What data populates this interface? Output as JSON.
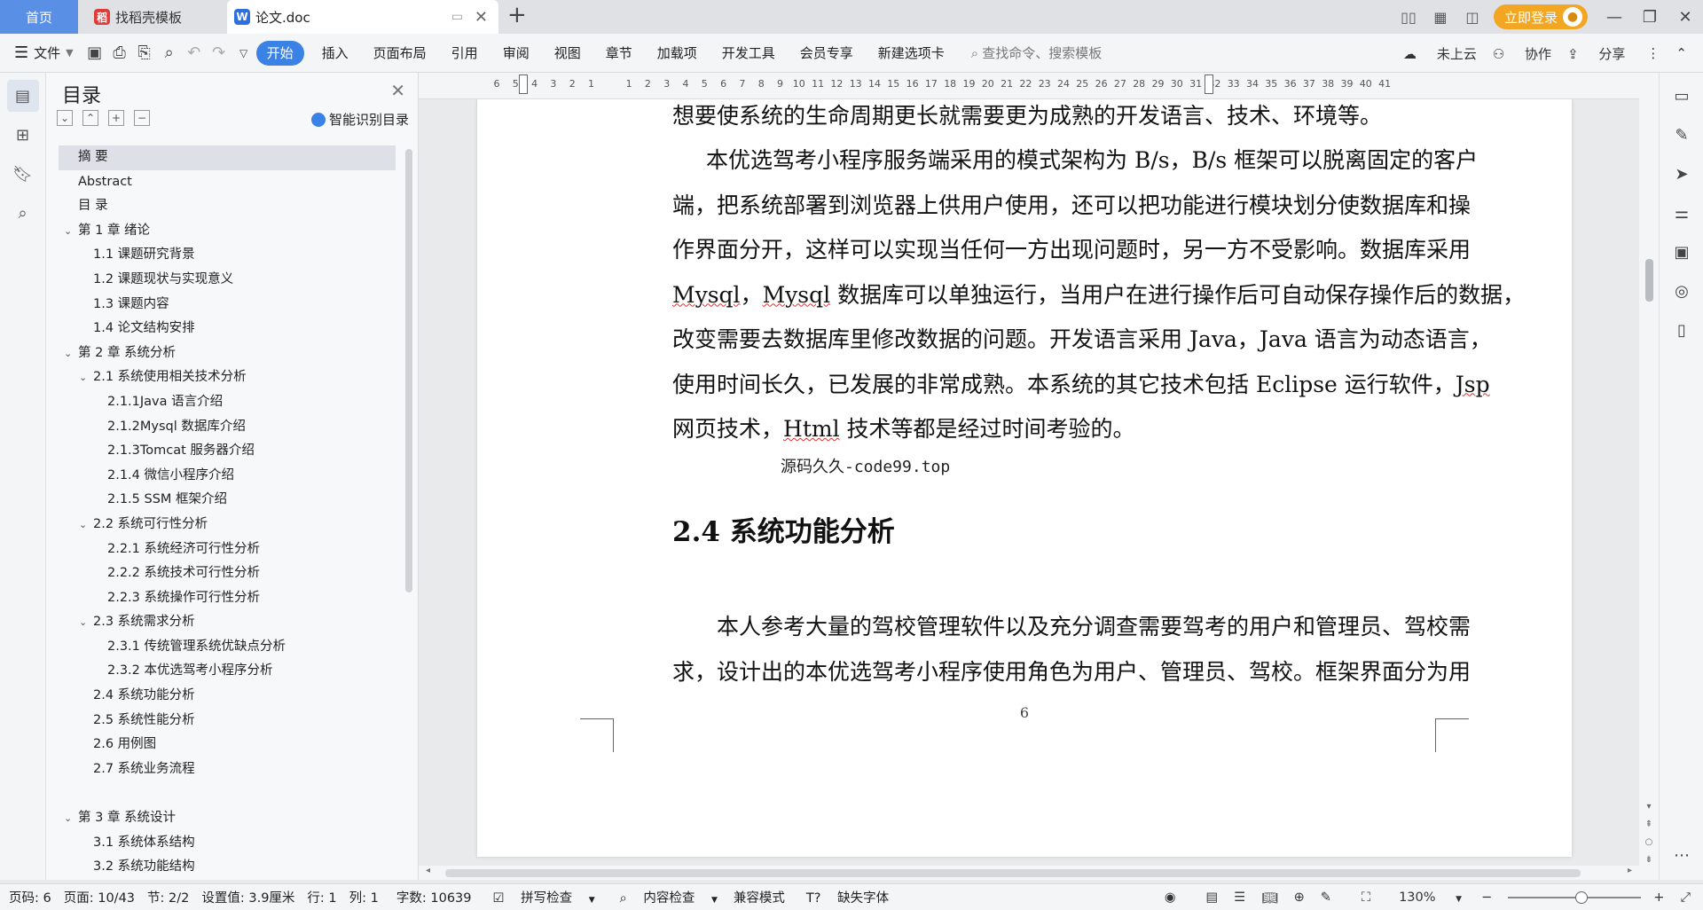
{
  "tabs": {
    "home": "首页",
    "find_template": "找稻壳模板",
    "document": "论文.doc"
  },
  "titlebar": {
    "login": "立即登录"
  },
  "menu": {
    "file": "文件",
    "items": [
      "开始",
      "插入",
      "页面布局",
      "引用",
      "审阅",
      "视图",
      "章节",
      "加载项",
      "开发工具",
      "会员专享",
      "新建选项卡"
    ],
    "search_placeholder": "查找命令、搜索模板",
    "cloud": "未上云",
    "collab": "协作",
    "share": "分享"
  },
  "toc": {
    "title": "目录",
    "smart": "智能识别目录",
    "items": [
      {
        "label": "摘  要",
        "level": 1,
        "caret": false,
        "selected": true
      },
      {
        "label": "Abstract",
        "level": 1,
        "caret": false
      },
      {
        "label": "目  录",
        "level": 1,
        "caret": false
      },
      {
        "label": "第 1 章   绪论",
        "level": 1,
        "caret": true
      },
      {
        "label": "1.1 课题研究背景",
        "level": 2,
        "caret": false
      },
      {
        "label": "1.2 课题现状与实现意义",
        "level": 2,
        "caret": false
      },
      {
        "label": "1.3 课题内容",
        "level": 2,
        "caret": false
      },
      {
        "label": "1.4 论文结构安排",
        "level": 2,
        "caret": false
      },
      {
        "label": "第 2 章   系统分析",
        "level": 1,
        "caret": true
      },
      {
        "label": "2.1 系统使用相关技术分析",
        "level": 2,
        "caret": true
      },
      {
        "label": "2.1.1Java 语言介绍",
        "level": 3,
        "caret": false
      },
      {
        "label": "2.1.2Mysql 数据库介绍",
        "level": 3,
        "caret": false
      },
      {
        "label": "2.1.3Tomcat 服务器介绍",
        "level": 3,
        "caret": false
      },
      {
        "label": "2.1.4 微信小程序介绍",
        "level": 3,
        "caret": false
      },
      {
        "label": "2.1.5 SSM 框架介绍",
        "level": 3,
        "caret": false
      },
      {
        "label": "2.2 系统可行性分析",
        "level": 2,
        "caret": true
      },
      {
        "label": "2.2.1 系统经济可行性分析",
        "level": 3,
        "caret": false
      },
      {
        "label": "2.2.2 系统技术可行性分析",
        "level": 3,
        "caret": false
      },
      {
        "label": "2.2.3 系统操作可行性分析",
        "level": 3,
        "caret": false
      },
      {
        "label": "2.3 系统需求分析",
        "level": 2,
        "caret": true
      },
      {
        "label": "2.3.1 传统管理系统优缺点分析",
        "level": 3,
        "caret": false
      },
      {
        "label": "2.3.2 本优选驾考小程序分析",
        "level": 3,
        "caret": false
      },
      {
        "label": "2.4 系统功能分析",
        "level": 2,
        "caret": false
      },
      {
        "label": "2.5 系统性能分析",
        "level": 2,
        "caret": false
      },
      {
        "label": "2.6 用例图",
        "level": 2,
        "caret": false
      },
      {
        "label": "2.7 系统业务流程",
        "level": 2,
        "caret": false
      },
      {
        "label": "",
        "level": 1,
        "caret": false
      },
      {
        "label": "第 3 章   系统设计",
        "level": 1,
        "caret": true
      },
      {
        "label": "3.1 系统体系结构",
        "level": 2,
        "caret": false
      },
      {
        "label": "3.2 系统功能结构",
        "level": 2,
        "caret": false
      }
    ]
  },
  "ruler": {
    "numbers": [
      "6",
      "5",
      "4",
      "3",
      "2",
      "1",
      "",
      "1",
      "2",
      "3",
      "4",
      "5",
      "6",
      "7",
      "8",
      "9",
      "10",
      "11",
      "12",
      "13",
      "14",
      "15",
      "16",
      "17",
      "18",
      "19",
      "20",
      "21",
      "22",
      "23",
      "24",
      "25",
      "26",
      "27",
      "28",
      "29",
      "30",
      "31",
      "32",
      "33",
      "34",
      "35",
      "36",
      "37",
      "38",
      "39",
      "40",
      "41"
    ]
  },
  "document": {
    "para1": [
      "想要使系统的生命周期更长就需要更为成熟的开发语言、技术、环境等。"
    ],
    "para2": {
      "l1": "本优选驾考小程序服务端采用的模式架构为 B/s，B/s 框架可以脱离固定的客户",
      "l2": "端，把系统部署到浏览器上供用户使用，还可以把功能进行模块划分使数据库和操",
      "l3": "作界面分开，这样可以实现当任何一方出现问题时，另一方不受影响。数据库采用",
      "l4a": "Mysql",
      "l4b": "，",
      "l4c": "Mysql",
      "l4d": " 数据库可以单独运行，当用户在进行操作后可自动保存操作后的数据，",
      "l5": "改变需要去数据库里修改数据的问题。开发语言采用 Java，Java 语言为动态语言，",
      "l6a": "使用时间长久，已发展的非常成熟。本系统的其它技术包括 Eclipse 运行软件，",
      "l6b": "Jsp",
      "l7a": "网页技术，",
      "l7b": "Html",
      "l7c": " 技术等都是经过时间考验的。"
    },
    "watermark": "源码久久-code99.top",
    "heading": "2.4 系统功能分析",
    "para3": {
      "l1": "本人参考大量的驾校管理软件以及充分调查需要驾考的用户和管理员、驾校需",
      "l2": "求，设计出的本优选驾考小程序使用角色为用户、管理员、驾校。框架界面分为用"
    },
    "page_number": "6"
  },
  "status": {
    "page_code": "页码: 6",
    "pages": "页面: 10/43",
    "section": "节: 2/2",
    "setting": "设置值: 3.9厘米",
    "row": "行: 1",
    "col": "列: 1",
    "words": "字数: 10639",
    "spell": "拼写检查",
    "content_check": "内容检查",
    "compat": "兼容模式",
    "missing_font": "缺失字体",
    "zoom": "130%",
    "zoom_level": 0.55
  }
}
